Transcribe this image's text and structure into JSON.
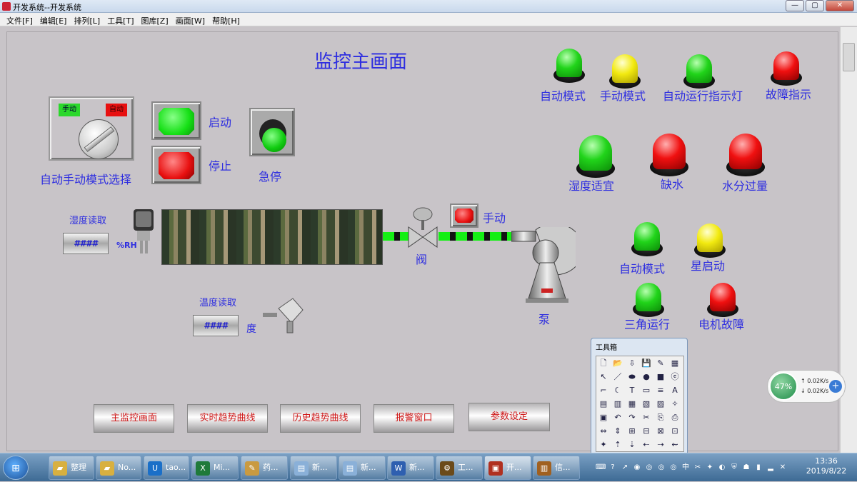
{
  "window": {
    "title": "开发系统--开发系统",
    "controls": [
      "—",
      "▢",
      "✕"
    ]
  },
  "menu": [
    "文件[F]",
    "编辑[E]",
    "排列[L]",
    "工具[T]",
    "图库[Z]",
    "画面[W]",
    "帮助[H]"
  ],
  "screen_title": "监控主画面",
  "selector": {
    "label": "自动手动模式选择",
    "manual": "手动",
    "auto": "自动"
  },
  "buttons": {
    "start": "启动",
    "stop": "停止",
    "estop": "急停",
    "manual": "手动"
  },
  "indicators": {
    "auto_mode": "自动模式",
    "manual_mode": "手动模式",
    "auto_run": "自动运行指示灯",
    "fault": "故障指示",
    "humidity_ok": "湿度适宜",
    "water_short": "缺水",
    "water_over": "水分过量",
    "auto_mode2": "自动模式",
    "star_start": "星启动",
    "delta_run": "三角运行",
    "motor_fault": "电机故障"
  },
  "humidity": {
    "title": "湿度读取",
    "value": "####",
    "unit": "%RH"
  },
  "temperature": {
    "title": "温度读取",
    "value": "####",
    "unit": "度"
  },
  "valve_label": "阀",
  "pump_label": "泵",
  "nav": [
    "主监控画面",
    "实时趋势曲线",
    "历史趋势曲线",
    "报警窗口",
    "参数设定"
  ],
  "toolbox": {
    "title": "工具箱",
    "tools": [
      "🗋",
      "📂",
      "⇩",
      "💾",
      "✎",
      "▦",
      "↖",
      "／",
      "⬬",
      "●",
      "■",
      "ⓔ",
      "⌐",
      "☾",
      "T",
      "▭",
      "≡",
      "A",
      "▤",
      "▥",
      "▦",
      "▧",
      "▨",
      "✧",
      "▣",
      "↶",
      "↷",
      "✂",
      "⎘",
      "⎙",
      "⇔",
      "⇕",
      "⊞",
      "⊟",
      "⊠",
      "⊡",
      "✦",
      "⇡",
      "⇣",
      "⇠",
      "⇢",
      "⇜"
    ]
  },
  "network": {
    "percent": "47%",
    "up": "0.02K/s",
    "down": "0.02K/s"
  },
  "taskbar": {
    "items": [
      {
        "label": "整理"
      },
      {
        "label": "No..."
      },
      {
        "label": "tao..."
      },
      {
        "label": "Mi..."
      },
      {
        "label": "药..."
      },
      {
        "label": "新..."
      },
      {
        "label": "新..."
      },
      {
        "label": "新..."
      },
      {
        "label": "工..."
      },
      {
        "label": "开..."
      },
      {
        "label": "信..."
      }
    ],
    "time": "13:36",
    "date": "2019/8/22"
  },
  "colors": {
    "green": "#21d41a",
    "yellow": "#f2ea10",
    "red": "#f01010",
    "text": "#2e2ee0",
    "nav_text": "#d01818"
  }
}
